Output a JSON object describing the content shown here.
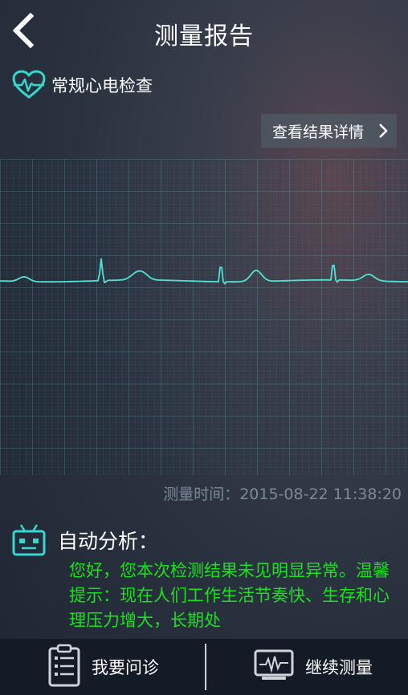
{
  "header": {
    "title": "测量报告",
    "back_icon": "back-arrow-icon"
  },
  "exam": {
    "icon": "heart-ecg-icon",
    "label": "常规心电检查",
    "accent": "#37d6cf"
  },
  "detail_button": {
    "label": "查看结果详情",
    "icon": "chevron-right-icon"
  },
  "ecg": {
    "trace_color": "#4fe3d6",
    "grid": true
  },
  "measure_time": {
    "label": "测量时间：",
    "value": "2015-08-22 11:38:20"
  },
  "analysis": {
    "icon": "robot-icon",
    "title": "自动分析：",
    "text": "您好，您本次检测结果未见明显异常。温馨提示：现在人们工作生活节奏快、生存和心理压力增大，长期处",
    "text_color": "#19e11c"
  },
  "footer": {
    "consult": {
      "label": "我要问诊",
      "icon": "clipboard-icon"
    },
    "continue": {
      "label": "继续测量",
      "icon": "monitor-ecg-icon"
    }
  }
}
